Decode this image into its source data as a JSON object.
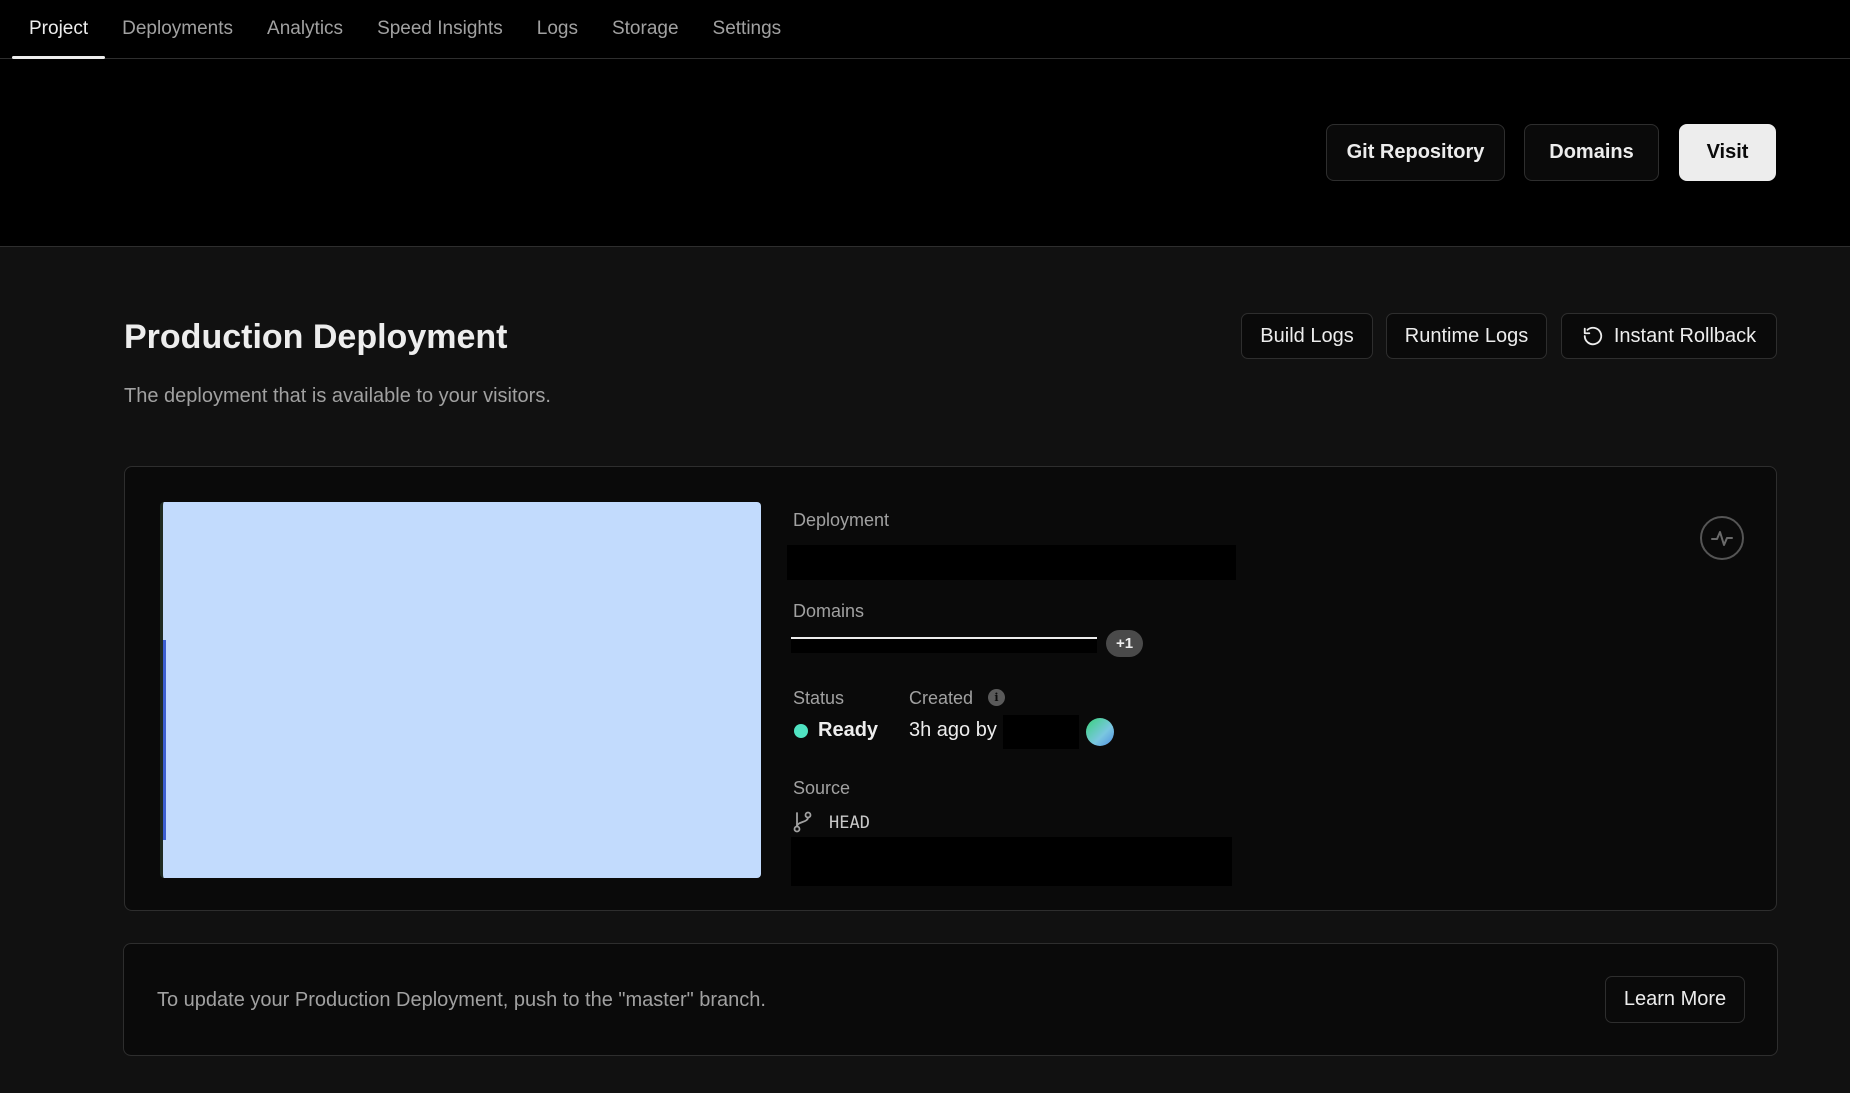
{
  "nav": {
    "tabs": [
      {
        "label": "Project",
        "active": true
      },
      {
        "label": "Deployments"
      },
      {
        "label": "Analytics"
      },
      {
        "label": "Speed Insights"
      },
      {
        "label": "Logs"
      },
      {
        "label": "Storage"
      },
      {
        "label": "Settings"
      }
    ]
  },
  "header": {
    "git_repository_label": "Git Repository",
    "domains_label": "Domains",
    "visit_label": "Visit"
  },
  "production": {
    "title": "Production Deployment",
    "subtitle": "The deployment that is available to your visitors.",
    "build_logs_label": "Build Logs",
    "runtime_logs_label": "Runtime Logs",
    "instant_rollback_label": "Instant Rollback"
  },
  "deployment": {
    "deployment_label": "Deployment",
    "domains_label": "Domains",
    "domains_extra_badge": "+1",
    "status_label": "Status",
    "status_value": "Ready",
    "status_color": "#50e3c2",
    "created_label": "Created",
    "created_value": "3h ago by",
    "source_label": "Source",
    "source_branch": "HEAD"
  },
  "banner": {
    "text": "To update your Production Deployment, push to the \"master\" branch.",
    "learn_more_label": "Learn More"
  },
  "icons": {
    "rollback": "rollback-icon",
    "info": "info-icon",
    "branch": "git-branch-icon",
    "activity": "activity-icon"
  }
}
